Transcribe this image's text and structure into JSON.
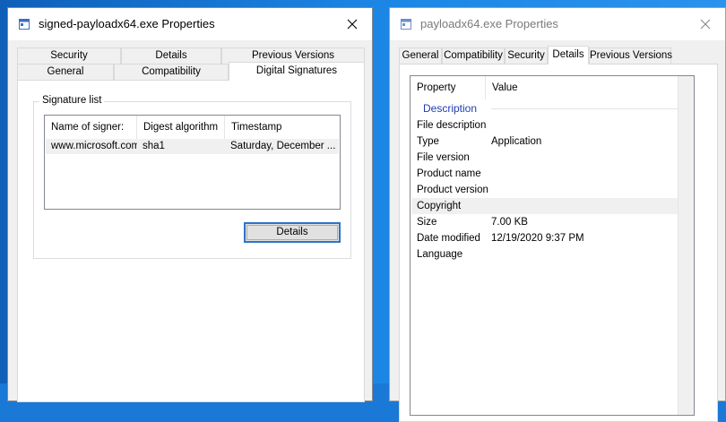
{
  "left_window": {
    "title": "signed-payloadx64.exe Properties",
    "tabs_back": [
      "Security",
      "Details",
      "Previous Versions"
    ],
    "tabs_front": [
      "General",
      "Compatibility",
      "Digital Signatures"
    ],
    "active_tab": "Digital Signatures",
    "group_label": "Signature list",
    "columns": [
      "Name of signer:",
      "Digest algorithm",
      "Timestamp"
    ],
    "rows": [
      {
        "signer": "www.microsoft.com",
        "digest": "sha1",
        "timestamp": "Saturday, December ..."
      }
    ],
    "details_button": "Details"
  },
  "right_window": {
    "title": "payloadx64.exe Properties",
    "tabs": [
      "General",
      "Compatibility",
      "Security",
      "Details",
      "Previous Versions"
    ],
    "active_tab": "Details",
    "columns": [
      "Property",
      "Value"
    ],
    "section_header": "Description",
    "properties": [
      {
        "name": "File description",
        "value": ""
      },
      {
        "name": "Type",
        "value": "Application"
      },
      {
        "name": "File version",
        "value": ""
      },
      {
        "name": "Product name",
        "value": ""
      },
      {
        "name": "Product version",
        "value": ""
      },
      {
        "name": "Copyright",
        "value": ""
      },
      {
        "name": "Size",
        "value": "7.00 KB"
      },
      {
        "name": "Date modified",
        "value": "12/19/2020 9:37 PM"
      },
      {
        "name": "Language",
        "value": ""
      }
    ]
  },
  "colors": {
    "desktop": "#1a78d6",
    "focus_border": "#2f73c8",
    "group_header": "#1e3cb4"
  },
  "icons": [
    "app-icon",
    "close-icon"
  ]
}
